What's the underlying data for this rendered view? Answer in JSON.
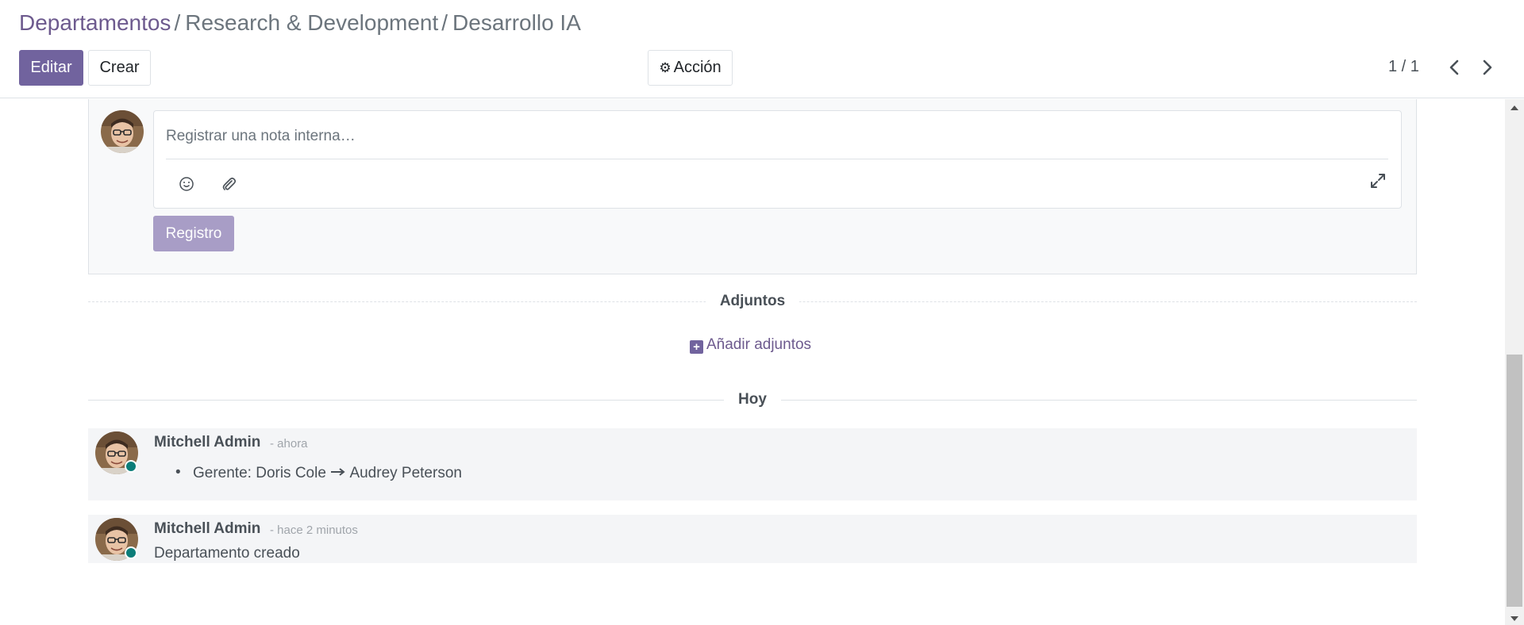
{
  "breadcrumb": {
    "root": "Departamentos",
    "separator": "/",
    "middle": "Research & Development",
    "current": "Desarrollo IA"
  },
  "toolbar": {
    "edit_label": "Editar",
    "create_label": "Crear",
    "action_label": "Acción",
    "action_icon": "gear-icon"
  },
  "pager": {
    "value": "1 / 1"
  },
  "composer": {
    "placeholder": "Registrar una nota interna…",
    "log_label": "Registro"
  },
  "attachments": {
    "title": "Adjuntos",
    "add_label": "Añadir adjuntos"
  },
  "thread": {
    "date_separator": "Hoy",
    "messages": [
      {
        "author": "Mitchell Admin",
        "date": "- ahora",
        "tracking_field": "Gerente:",
        "tracking_old": "Doris Cole",
        "tracking_new": "Audrey Peterson"
      },
      {
        "author": "Mitchell Admin",
        "date": "- hace 2 minutos",
        "body": "Departamento creado"
      }
    ]
  },
  "colors": {
    "primary": "#71639e",
    "link": "#6d5a8e",
    "online": "#0c7d79"
  }
}
